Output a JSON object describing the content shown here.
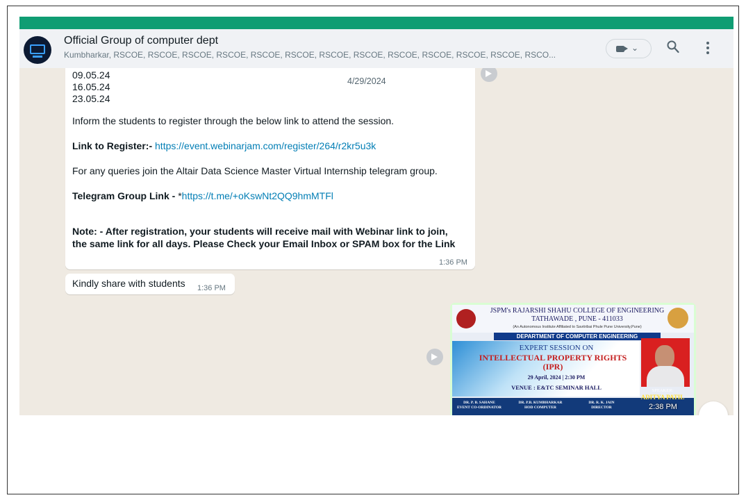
{
  "group": {
    "title": "Official Group of computer dept",
    "members": "Kumbharkar, RSCOE, RSCOE, RSCOE, RSCOE, RSCOE, RSCOE, RSCOE, RSCOE, RSCOE, RSCOE, RSCOE, RSCOE, RSCO..."
  },
  "icons": {
    "video": "video-camera-icon",
    "search": "search-icon",
    "menu": "kebab-menu-icon"
  },
  "date_chip": "4/29/2024",
  "message1": {
    "dates": [
      "09.05.24",
      "16.05.24",
      "23.05.24"
    ],
    "inform": " Inform the students to register through the below link to attend the session.",
    "register_label": "Link to Register:-",
    "register_link": "https://event.webinarjam.com/register/264/r2kr5u3k",
    "queries": "For any queries join the Altair Data Science Master Virtual Internship telegram group.",
    "telegram_label": "Telegram Group Link -",
    "telegram_prefix": " *",
    "telegram_link": "https://t.me/+oKswNt2QQ9hmMTFl",
    "note": "Note: - After registration, your students will receive mail with Webinar link to join, the same link for all days. Please Check your Email Inbox or SPAM box for the Link",
    "time": "1:36 PM"
  },
  "message2": {
    "text": "Kindly share with students",
    "time": "1:36 PM"
  },
  "poster": {
    "institute_line1": "JSPM's RAJARSHI SHAHU COLLEGE OF ENGINEERING",
    "institute_line2": "TATHAWADE , PUNE - 411033",
    "affiliation": "(An Autonomous Institute Affiliated to Savitribai Phule Pune University,Pune)",
    "department": "DEPARTMENT OF COMPUTER ENGINEERING",
    "expert": "EXPERT SESSION ON",
    "topic_line1": "INTELLECTUAL PROPERTY RIGHTS",
    "topic_line2": "(IPR)",
    "date": "29 April, 2024 | 2:30 PM",
    "venue": "VENUE : E&TC SEMINAR HALL",
    "speaker_label": "SPEAKER:",
    "speaker_name": "ADITYA PATIL",
    "sig1_name": "DR. P. B. SAHANE",
    "sig1_role": "EVENT CO-ORDINATOR",
    "sig2_name": "DR. P.B. KUMBHARKAR",
    "sig2_role": "HOD COMPUTER",
    "sig3_name": "DR. R. K. JAIN",
    "sig3_role": "DIRECTOR"
  },
  "image_time": "2:38 PM"
}
